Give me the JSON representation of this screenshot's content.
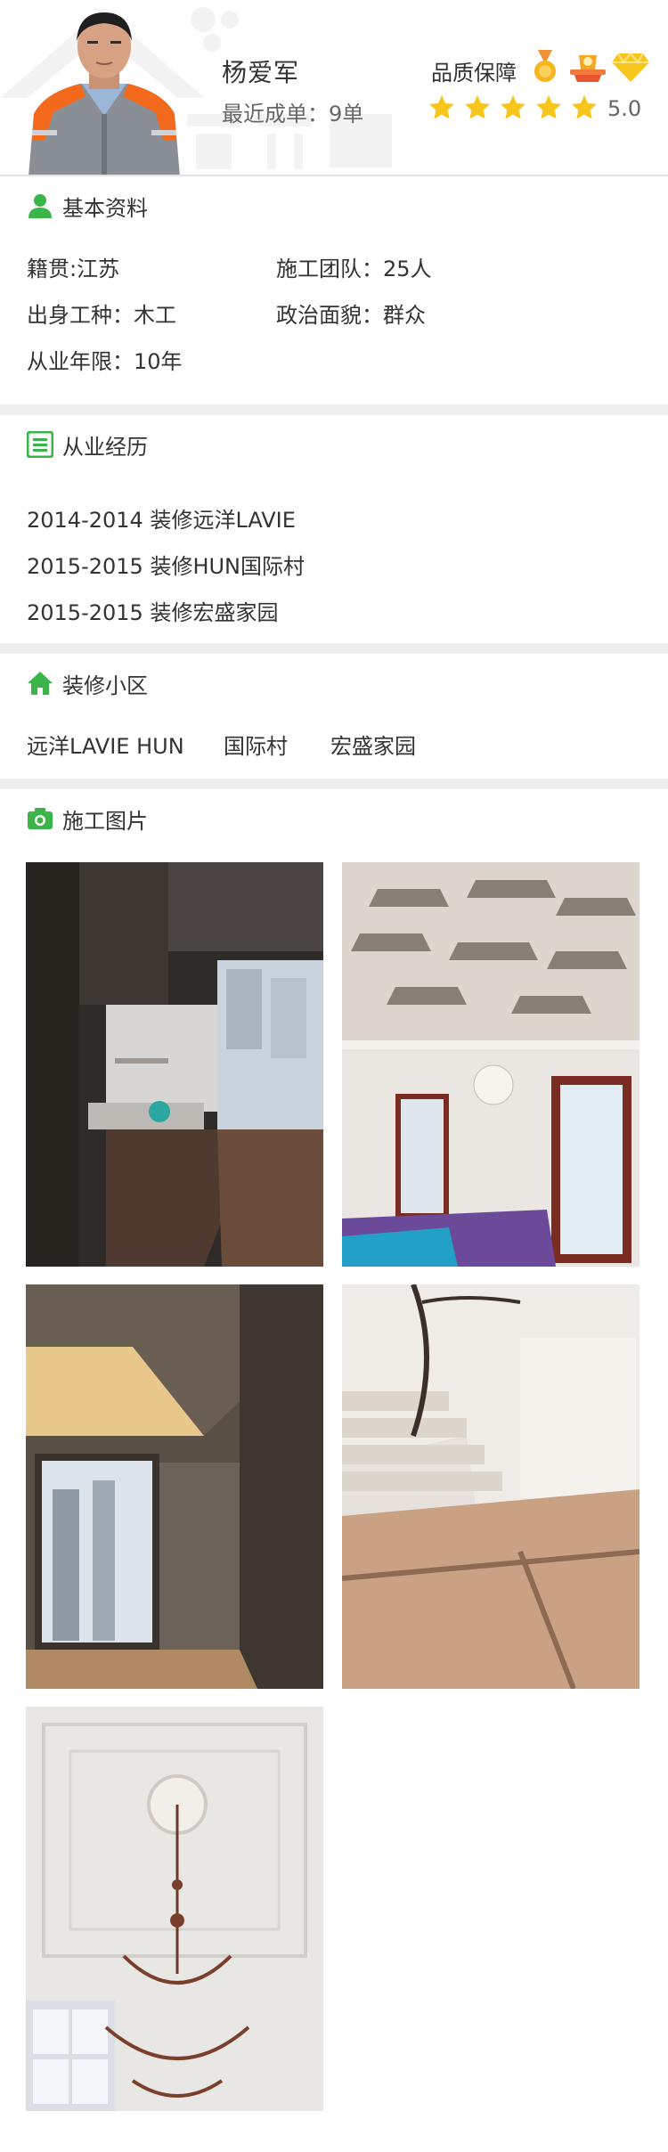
{
  "profile": {
    "name": "杨爱军",
    "recent_deals": "最近成单：9单",
    "quality_label": "品质保障",
    "rating": "5.0",
    "stars": 5,
    "badges": [
      "medal-badge-icon",
      "trophy-badge-icon",
      "diamond-badge-icon"
    ]
  },
  "basic": {
    "title": "基本资料",
    "icon": "person-icon",
    "hometown": "籍贯:江苏",
    "team": "施工团队：25人",
    "trade": "出身工种：木工",
    "politics": "政治面貌：群众",
    "years": "从业年限：10年"
  },
  "experience": {
    "title": "从业经历",
    "icon": "list-icon",
    "items": [
      "2014-2014 装修远洋LAVIE",
      "2015-2015 装修HUN国际村",
      "2015-2015 装修宏盛家园"
    ]
  },
  "communities": {
    "title": "装修小区",
    "icon": "home-icon",
    "items": [
      "远洋LAVIE HUN",
      "国际村",
      "宏盛家园"
    ]
  },
  "photos": {
    "title": "施工图片",
    "icon": "camera-icon",
    "items": [
      "kitchen-photo",
      "ceiling-living-room-photo",
      "apartment-corridor-photo",
      "staircase-photo",
      "chandelier-hall-photo"
    ]
  },
  "colors": {
    "accent_green": "#3bb54a",
    "star_yellow": "#f8c51c",
    "text_dark": "#333333",
    "text_gray": "#666666",
    "divider": "#efefef"
  }
}
